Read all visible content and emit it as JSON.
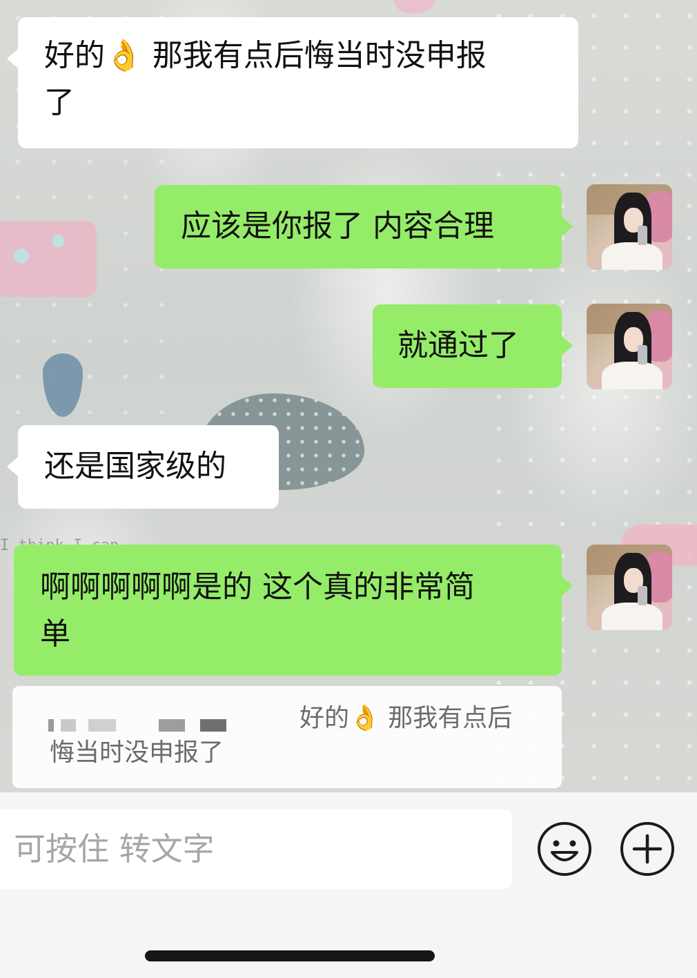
{
  "messages": [
    {
      "side": "incoming",
      "text_line1": "好的👌 那我有点后悔当时没申报",
      "text_line2": "了"
    },
    {
      "side": "outgoing",
      "text": "应该是你报了 内容合理"
    },
    {
      "side": "outgoing",
      "text": "就通过了"
    },
    {
      "side": "incoming",
      "text": "还是国家级的"
    },
    {
      "side": "outgoing",
      "text_line1": "啊啊啊啊啊是的 这个真的非常简",
      "text_line2": "单"
    }
  ],
  "quote": {
    "line1": "好的👌 那我有点后",
    "line2": "悔当时没申报了"
  },
  "background_text": "I think I can",
  "input": {
    "placeholder": "可按住 转文字"
  },
  "icons": {
    "emoji": "smiley-face-icon",
    "plus": "plus-circle-icon"
  },
  "colors": {
    "outgoing_bubble": "#95ec69",
    "incoming_bubble": "#ffffff"
  }
}
